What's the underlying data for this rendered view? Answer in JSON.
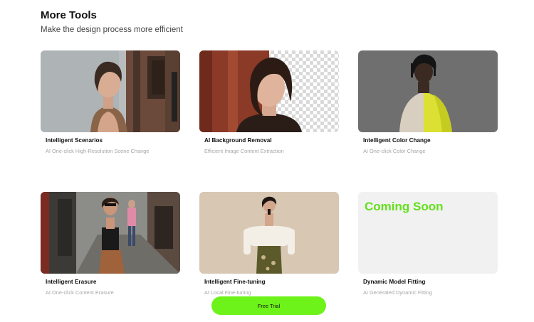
{
  "section": {
    "title": "More Tools",
    "subtitle": "Make the design process more efficient"
  },
  "tools": [
    {
      "title": "Intelligent Scenarios",
      "desc": "AI One-click High-Resolution Scene Change"
    },
    {
      "title": "AI Background Removal",
      "desc": "Efficient Image Content Extraction"
    },
    {
      "title": "Intelligent Color Change",
      "desc": "AI One-click Color Change"
    },
    {
      "title": "Intelligent Erasure",
      "desc": "AI One-click Content Erasure"
    },
    {
      "title": "Intelligent Fine-tuning",
      "desc": "AI Local Fine-tuning"
    },
    {
      "title": "Dynamic Model Fitting",
      "desc": "AI Generated Dynamic Fitting",
      "placeholder": "Coming Soon"
    }
  ],
  "cta": {
    "label": "Free Trial"
  },
  "colors": {
    "accent": "#6df21a",
    "coming_soon_text": "#63e01c",
    "placeholder_bg": "#f1f1f1"
  }
}
